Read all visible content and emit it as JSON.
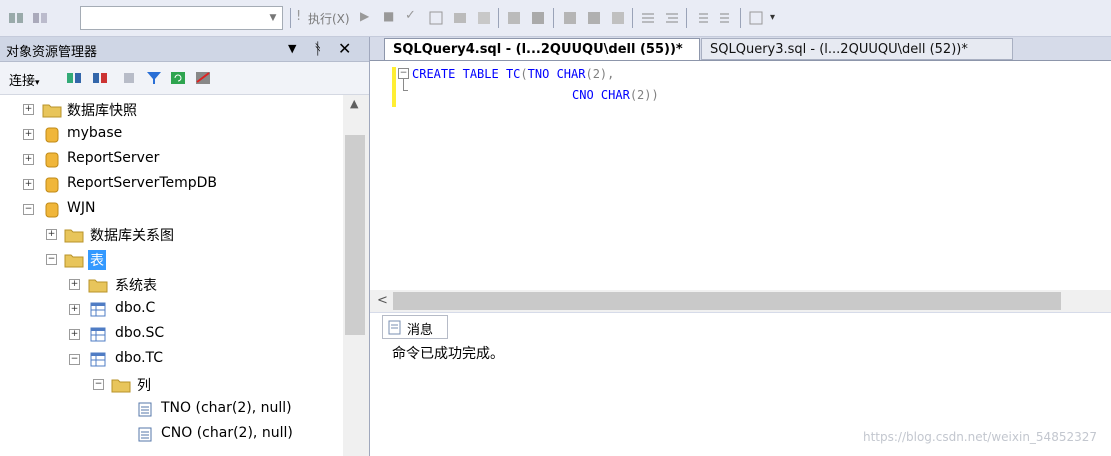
{
  "toolbar": {
    "database_combo_value": "",
    "execute_label": "执行(X)",
    "icons": [
      "connect-icon",
      "disconnect-icon",
      "execute-icon",
      "stop-icon",
      "parse-icon",
      "display-plan-icon",
      "query-options-icon",
      "results-to-text-icon",
      "results-to-grid-icon",
      "results-to-file-icon",
      "comment-icon",
      "uncomment-icon",
      "outdent-icon",
      "indent-icon",
      "specify-values-icon"
    ]
  },
  "object_explorer": {
    "title": "对象资源管理器",
    "connect_label": "连接",
    "tree": [
      {
        "label": "数据库快照",
        "type": "folder",
        "expanded": false
      },
      {
        "label": "mybase",
        "type": "database",
        "expanded": false
      },
      {
        "label": "ReportServer",
        "type": "database",
        "expanded": false
      },
      {
        "label": "ReportServerTempDB",
        "type": "database",
        "expanded": false
      },
      {
        "label": "WJN",
        "type": "database",
        "expanded": true
      },
      {
        "label": "数据库关系图",
        "type": "folder",
        "expanded": false
      },
      {
        "label": "表",
        "type": "folder",
        "expanded": true,
        "selected": true
      },
      {
        "label": "系统表",
        "type": "folder",
        "expanded": false
      },
      {
        "label": "dbo.C",
        "type": "table",
        "expanded": false
      },
      {
        "label": "dbo.SC",
        "type": "table",
        "expanded": false
      },
      {
        "label": "dbo.TC",
        "type": "table",
        "expanded": true
      },
      {
        "label": "列",
        "type": "folder",
        "expanded": true
      },
      {
        "label": "TNO (char(2), null)",
        "type": "column"
      },
      {
        "label": "CNO (char(2), null)",
        "type": "column"
      }
    ]
  },
  "editor": {
    "tabs": [
      {
        "label": "SQLQuery4.sql - (l...2QUUQU\\dell (55))*",
        "active": true
      },
      {
        "label": "SQLQuery3.sql - (l...2QUUQU\\dell (52))*",
        "active": false
      }
    ],
    "code": {
      "line1": {
        "kw1": "CREATE",
        "kw2": "TABLE",
        "name": "TC",
        "open": "(",
        "col": "TNO",
        "type": "CHAR",
        "args": "(2),"
      },
      "line2": {
        "col": "CNO",
        "type": "CHAR",
        "args": "(2))"
      }
    }
  },
  "results": {
    "tab_label": "消息",
    "message": "命令已成功完成。"
  },
  "watermark": "https://blog.csdn.net/weixin_54852327",
  "colors": {
    "keyword": "#0000ff",
    "selection": "#3399ff",
    "header_bg": "#cfd6e5"
  }
}
